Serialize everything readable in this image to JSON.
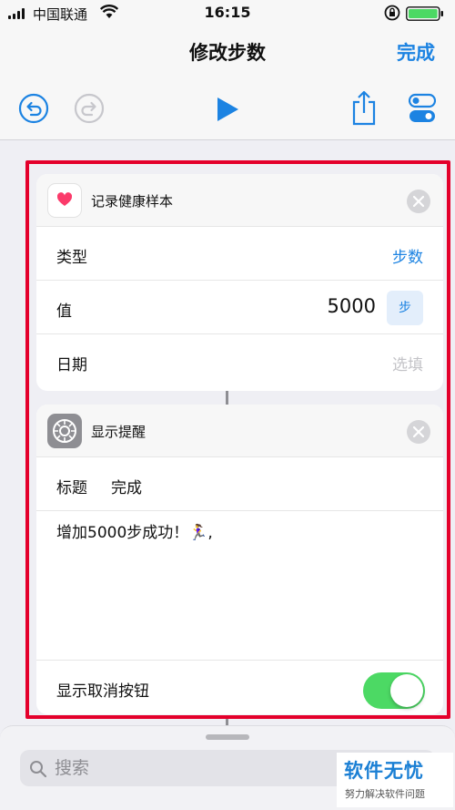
{
  "status_bar": {
    "carrier": "中国联通",
    "time": "16:15"
  },
  "nav": {
    "title": "修改步数",
    "done_label": "完成"
  },
  "colors": {
    "accent": "#1c83e2",
    "highlight_frame": "#e4002b",
    "toggle_on": "#4cd964",
    "battery": "#4cd964"
  },
  "toolbar": {
    "icons": [
      "undo-icon",
      "redo-icon",
      "play-icon",
      "share-icon",
      "settings-toggle-icon"
    ]
  },
  "health_card": {
    "title": "记录健康样本",
    "icon": "heart-icon",
    "rows": {
      "type_label": "类型",
      "type_value": "步数",
      "value_label": "值",
      "value_number": "5000",
      "value_unit": "步",
      "date_label": "日期",
      "date_placeholder": "选填"
    }
  },
  "alert_card": {
    "title": "显示提醒",
    "icon": "gear-icon",
    "title_label": "标题",
    "title_value": "完成",
    "message": "增加5000步成功！🏃‍♀️,",
    "cancel_label": "显示取消按钮",
    "cancel_toggle_on": true
  },
  "bottom_sheet": {
    "search_placeholder": "搜索"
  },
  "watermark": {
    "main": "软件无忧",
    "sub": "努力解决软件问题"
  }
}
